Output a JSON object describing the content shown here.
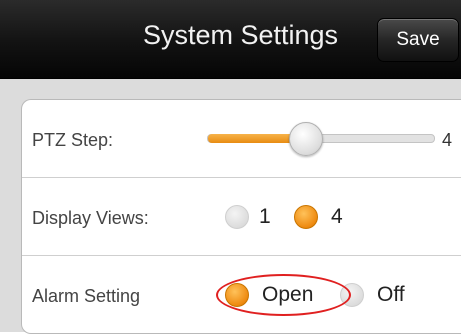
{
  "header": {
    "title": "System Settings",
    "save_label": "Save"
  },
  "settings": {
    "ptz_step": {
      "label": "PTZ Step:",
      "value": "4",
      "fill_fraction": 0.43
    },
    "display_views": {
      "label": "Display Views:",
      "options": [
        "1",
        "4"
      ],
      "selected": "4"
    },
    "alarm_setting": {
      "label": "Alarm Setting",
      "options": [
        "Open",
        "Off"
      ],
      "selected": "Open"
    }
  },
  "colors": {
    "accent": "#ee8a10",
    "highlight_circle": "#e02020"
  }
}
